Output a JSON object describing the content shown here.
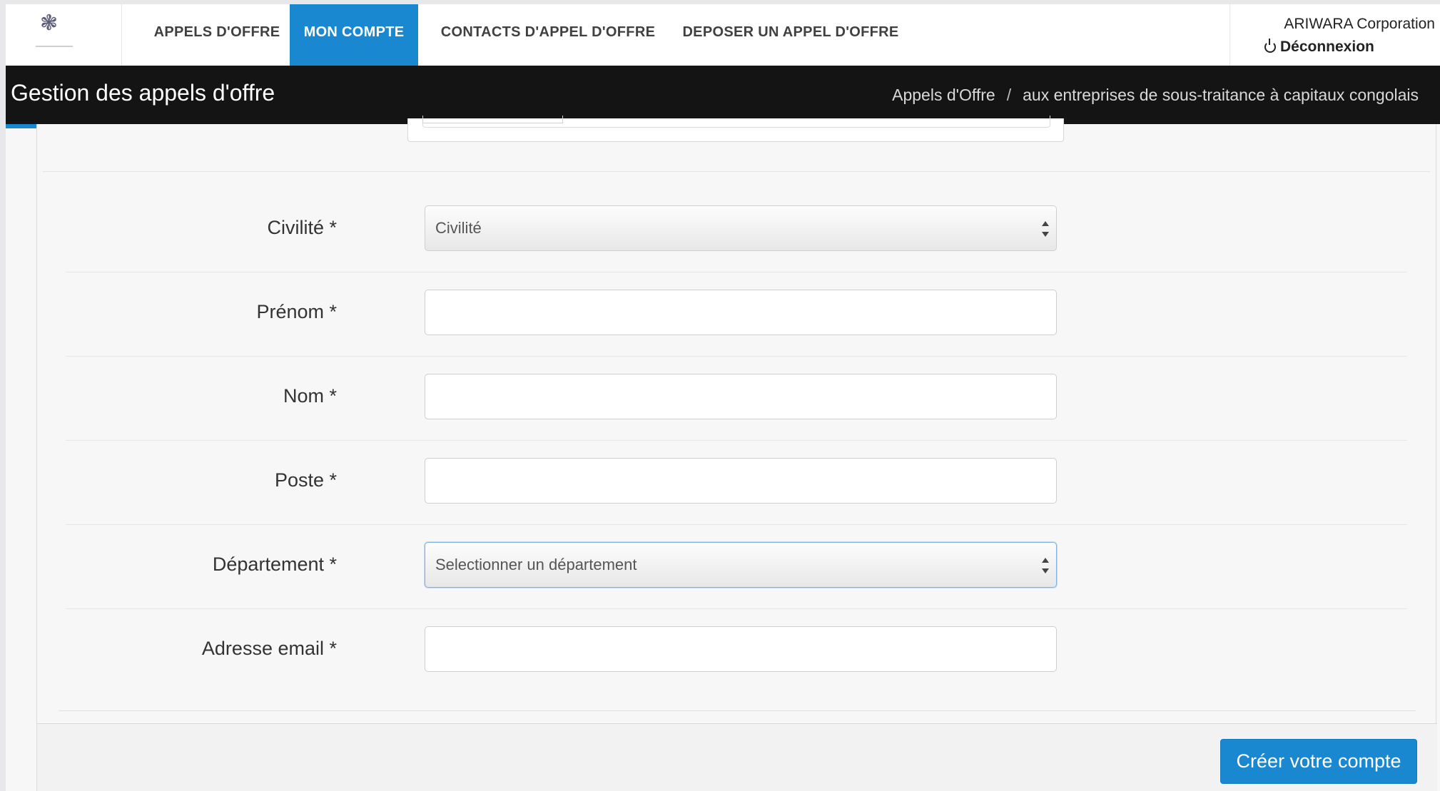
{
  "nav": {
    "items": [
      {
        "label": "APPELS D'OFFRE"
      },
      {
        "label": "MON COMPTE"
      },
      {
        "label": "CONTACTS D'APPEL D'OFFRE"
      },
      {
        "label": "DEPOSER UN APPEL D'OFFRE"
      }
    ],
    "active_index": 1
  },
  "user": {
    "company": "ARIWARA Corporation",
    "logout_label": "Déconnexion"
  },
  "banner": {
    "title": "Gestion des appels d'offre",
    "breadcrumb": [
      "Appels d'Offre",
      "aux entreprises de sous-traitance à capitaux congolais"
    ],
    "separator": "/"
  },
  "form": {
    "fields": [
      {
        "label": "Civilité *",
        "type": "select",
        "value": "Civilité"
      },
      {
        "label": "Prénom *",
        "type": "text",
        "value": ""
      },
      {
        "label": "Nom *",
        "type": "text",
        "value": ""
      },
      {
        "label": "Poste *",
        "type": "text",
        "value": ""
      },
      {
        "label": "Département *",
        "type": "select",
        "value": "Selectionner un département"
      },
      {
        "label": "Adresse email *",
        "type": "text",
        "value": ""
      }
    ],
    "submit_label": "Créer votre compte"
  },
  "colors": {
    "accent": "#1a88d0",
    "banner_bg": "#141414"
  }
}
